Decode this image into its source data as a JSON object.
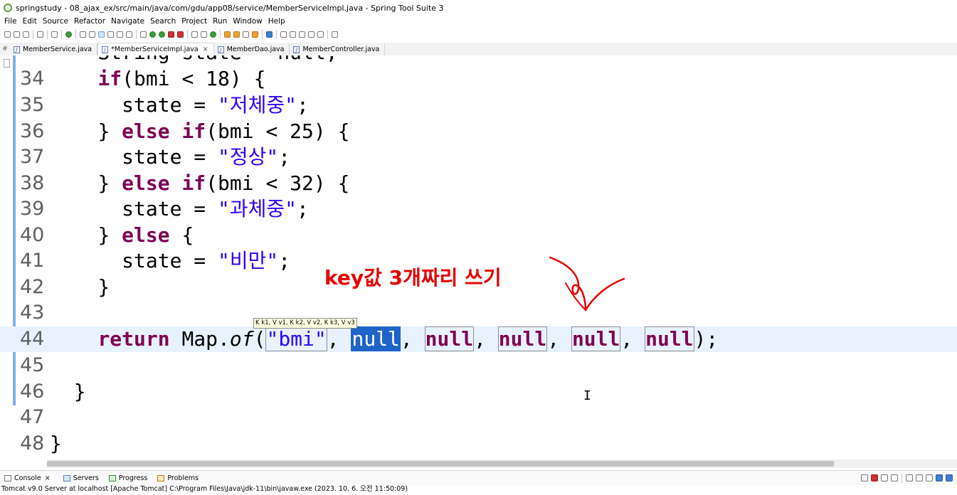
{
  "window": {
    "title": "springstudy - 08_ajax_ex/src/main/java/com/gdu/app08/service/MemberServiceImpl.java - Spring Tool Suite 3"
  },
  "menu": [
    "File",
    "Edit",
    "Source",
    "Refactor",
    "Navigate",
    "Search",
    "Project",
    "Run",
    "Window",
    "Help"
  ],
  "tabs": [
    {
      "label": "MemberService.java"
    },
    {
      "label": "*MemberServiceImpl.java",
      "close": "×"
    },
    {
      "label": "MemberDao.java"
    },
    {
      "label": "MemberController.java"
    }
  ],
  "code": {
    "partial_top": "    String state = null;",
    "lines": [
      {
        "num": "34"
      },
      {
        "num": "35"
      },
      {
        "num": "36"
      },
      {
        "num": "37"
      },
      {
        "num": "38"
      },
      {
        "num": "39"
      },
      {
        "num": "40"
      },
      {
        "num": "41"
      },
      {
        "num": "42"
      },
      {
        "num": "43"
      },
      {
        "num": "44"
      },
      {
        "num": "45"
      },
      {
        "num": "46"
      },
      {
        "num": "47"
      },
      {
        "num": "48"
      }
    ],
    "tokens": {
      "if": "if",
      "else": "else",
      "return": "return",
      "bmi_lt_18": "(bmi < 18) {",
      "bmi_lt_25": "(bmi < 25) {",
      "bmi_lt_32": "(bmi < 32) {",
      "state_eq": "state = ",
      "str_underweight": "\"저체중\"",
      "str_normal": "\"정상\"",
      "str_overweight": "\"과체중\"",
      "str_obese": "\"비만\"",
      "semicolon": ";",
      "close_else": "} ",
      "open_brace": " {",
      "close_brace": "}",
      "map": " Map.",
      "of": "of",
      "paren_open": "(",
      "str_bmi": "\"bmi\"",
      "comma": ", ",
      "null": "null",
      "paren_close_semicolon": ");"
    }
  },
  "param_hint": "K k1, V v1, K k2, V v2, K k3, V v3",
  "annotation": "key값 3개짜리 쓰기",
  "bottom": {
    "tabs": [
      "Console",
      "Servers",
      "Progress",
      "Problems"
    ],
    "console_close": "×",
    "status": "Tomcat v9.0 Server at localhost [Apache Tomcat] C:\\Program Files\\Java\\jdk-11\\bin\\javaw.exe  (2023. 10. 6. 오전 11:50:09)"
  },
  "colors": {
    "keyword": "#7f0055",
    "string": "#2a00ff",
    "annotation": "#e60000",
    "selection": "#1e63c8"
  }
}
